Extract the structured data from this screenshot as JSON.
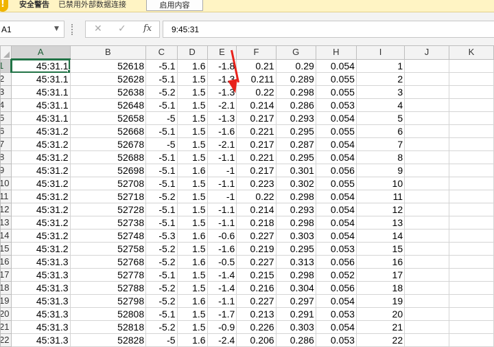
{
  "security_bar": {
    "title": "安全警告",
    "message": "已禁用外部数据连接",
    "button": "启用内容",
    "icon": "warning-icon",
    "color": "#f0b400"
  },
  "formula_bar": {
    "name_box": "A1",
    "formula": "9:45:31",
    "cancel_icon": "close-icon",
    "enter_icon": "check-icon",
    "fx_label": "fx"
  },
  "sheet": {
    "columns": [
      "A",
      "B",
      "C",
      "D",
      "E",
      "F",
      "G",
      "H",
      "I",
      "J",
      "K"
    ],
    "rows": [
      {
        "n": "1",
        "c": [
          "45:31.1",
          "52618",
          "-5.1",
          "1.6",
          "-1.8",
          "0.21",
          "0.29",
          "0.054",
          "1"
        ]
      },
      {
        "n": "2",
        "c": [
          "45:31.1",
          "52628",
          "-5.1",
          "1.5",
          "-1.3",
          "0.211",
          "0.289",
          "0.055",
          "2"
        ]
      },
      {
        "n": "3",
        "c": [
          "45:31.1",
          "52638",
          "-5.2",
          "1.5",
          "-1.3",
          "0.22",
          "0.298",
          "0.055",
          "3"
        ]
      },
      {
        "n": "4",
        "c": [
          "45:31.1",
          "52648",
          "-5.1",
          "1.5",
          "-2.1",
          "0.214",
          "0.286",
          "0.053",
          "4"
        ]
      },
      {
        "n": "5",
        "c": [
          "45:31.1",
          "52658",
          "-5",
          "1.5",
          "-1.3",
          "0.217",
          "0.293",
          "0.054",
          "5"
        ]
      },
      {
        "n": "6",
        "c": [
          "45:31.2",
          "52668",
          "-5.1",
          "1.5",
          "-1.6",
          "0.221",
          "0.295",
          "0.055",
          "6"
        ]
      },
      {
        "n": "7",
        "c": [
          "45:31.2",
          "52678",
          "-5",
          "1.5",
          "-2.1",
          "0.217",
          "0.287",
          "0.054",
          "7"
        ]
      },
      {
        "n": "8",
        "c": [
          "45:31.2",
          "52688",
          "-5.1",
          "1.5",
          "-1.1",
          "0.221",
          "0.295",
          "0.054",
          "8"
        ]
      },
      {
        "n": "9",
        "c": [
          "45:31.2",
          "52698",
          "-5.1",
          "1.6",
          "-1",
          "0.217",
          "0.301",
          "0.056",
          "9"
        ]
      },
      {
        "n": "10",
        "c": [
          "45:31.2",
          "52708",
          "-5.1",
          "1.5",
          "-1.1",
          "0.223",
          "0.302",
          "0.055",
          "10"
        ]
      },
      {
        "n": "11",
        "c": [
          "45:31.2",
          "52718",
          "-5.2",
          "1.5",
          "-1",
          "0.22",
          "0.298",
          "0.054",
          "11"
        ]
      },
      {
        "n": "12",
        "c": [
          "45:31.2",
          "52728",
          "-5.1",
          "1.5",
          "-1.1",
          "0.214",
          "0.293",
          "0.054",
          "12"
        ]
      },
      {
        "n": "13",
        "c": [
          "45:31.2",
          "52738",
          "-5.1",
          "1.5",
          "-1.1",
          "0.218",
          "0.298",
          "0.054",
          "13"
        ]
      },
      {
        "n": "14",
        "c": [
          "45:31.2",
          "52748",
          "-5.3",
          "1.6",
          "-0.6",
          "0.227",
          "0.303",
          "0.054",
          "14"
        ]
      },
      {
        "n": "15",
        "c": [
          "45:31.2",
          "52758",
          "-5.2",
          "1.5",
          "-1.6",
          "0.219",
          "0.295",
          "0.053",
          "15"
        ]
      },
      {
        "n": "16",
        "c": [
          "45:31.3",
          "52768",
          "-5.2",
          "1.6",
          "-0.5",
          "0.227",
          "0.313",
          "0.056",
          "16"
        ]
      },
      {
        "n": "17",
        "c": [
          "45:31.3",
          "52778",
          "-5.1",
          "1.5",
          "-1.4",
          "0.215",
          "0.298",
          "0.052",
          "17"
        ]
      },
      {
        "n": "18",
        "c": [
          "45:31.3",
          "52788",
          "-5.2",
          "1.5",
          "-1.4",
          "0.216",
          "0.304",
          "0.056",
          "18"
        ]
      },
      {
        "n": "19",
        "c": [
          "45:31.3",
          "52798",
          "-5.2",
          "1.6",
          "-1.1",
          "0.227",
          "0.297",
          "0.054",
          "19"
        ]
      },
      {
        "n": "20",
        "c": [
          "45:31.3",
          "52808",
          "-5.1",
          "1.5",
          "-1.7",
          "0.213",
          "0.291",
          "0.053",
          "20"
        ]
      },
      {
        "n": "21",
        "c": [
          "45:31.3",
          "52818",
          "-5.2",
          "1.5",
          "-0.9",
          "0.226",
          "0.303",
          "0.054",
          "21"
        ]
      },
      {
        "n": "22",
        "c": [
          "45:31.3",
          "52828",
          "-5",
          "1.6",
          "-2.4",
          "0.206",
          "0.286",
          "0.053",
          "22"
        ]
      }
    ]
  },
  "accent_color": "#217346",
  "annotation_color": "#e8221b"
}
